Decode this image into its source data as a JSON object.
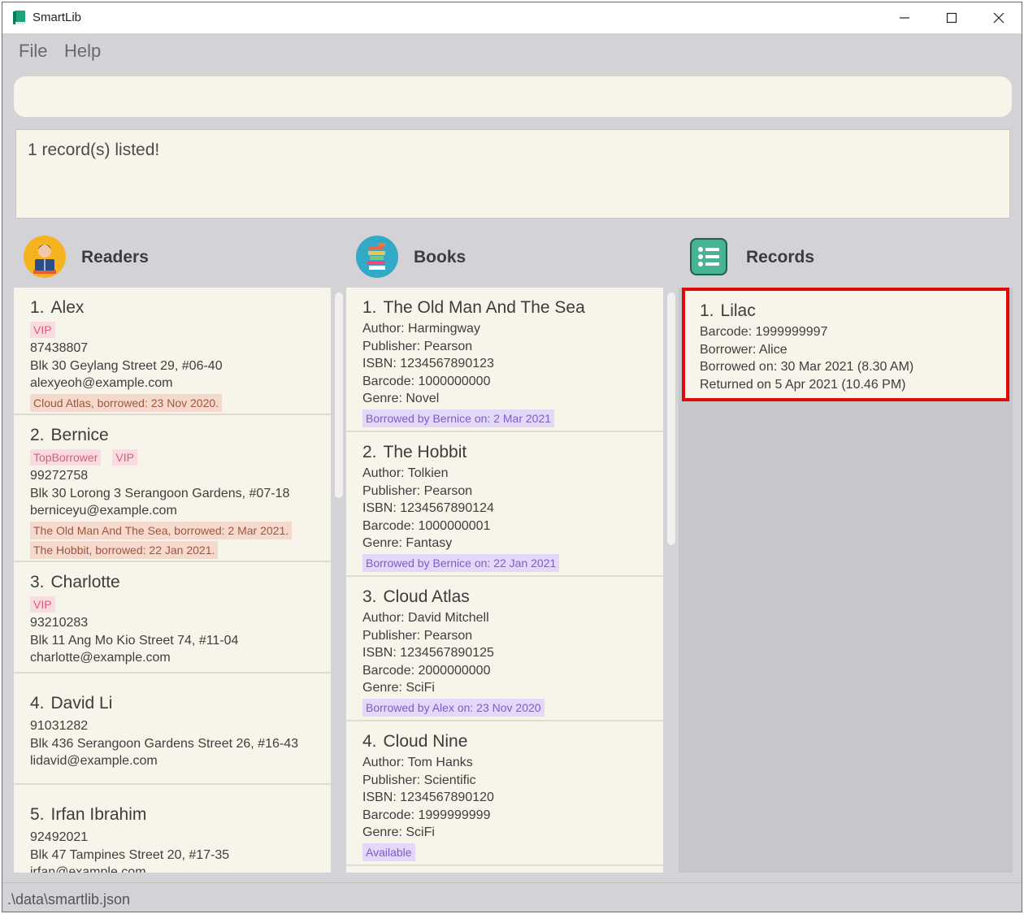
{
  "window": {
    "title": "SmartLib"
  },
  "menu": {
    "file": "File",
    "help": "Help"
  },
  "command": {
    "value": ""
  },
  "result": {
    "text": "1 record(s) listed!"
  },
  "panels": {
    "readers": "Readers",
    "books": "Books",
    "records": "Records"
  },
  "readers": [
    {
      "index": "1.",
      "name": "Alex",
      "tags": [
        "VIP"
      ],
      "phone": "87438807",
      "address": "Blk 30 Geylang Street 29, #06-40",
      "email": "alexyeoh@example.com",
      "borrowed": [
        "Cloud Atlas, borrowed: 23 Nov 2020."
      ]
    },
    {
      "index": "2.",
      "name": "Bernice",
      "tags": [
        "TopBorrower",
        "VIP"
      ],
      "phone": "99272758",
      "address": "Blk 30 Lorong 3 Serangoon Gardens, #07-18",
      "email": "berniceyu@example.com",
      "borrowed": [
        "The Old Man And The Sea, borrowed: 2 Mar 2021.",
        "The Hobbit, borrowed: 22 Jan 2021."
      ]
    },
    {
      "index": "3.",
      "name": "Charlotte",
      "tags": [
        "VIP"
      ],
      "phone": "93210283",
      "address": "Blk 11 Ang Mo Kio Street 74, #11-04",
      "email": "charlotte@example.com",
      "borrowed": []
    },
    {
      "index": "4.",
      "name": "David Li",
      "tags": [],
      "phone": "91031282",
      "address": "Blk 436 Serangoon Gardens Street 26, #16-43",
      "email": "lidavid@example.com",
      "borrowed": []
    },
    {
      "index": "5.",
      "name": "Irfan Ibrahim",
      "tags": [],
      "phone": "92492021",
      "address": "Blk 47 Tampines Street 20, #17-35",
      "email": "irfan@example.com",
      "borrowed": []
    }
  ],
  "books": [
    {
      "index": "1.",
      "title": "The Old Man And The Sea",
      "author": "Author: Harmingway",
      "publisher": "Publisher: Pearson",
      "isbn": "ISBN: 1234567890123",
      "barcode": "Barcode: 1000000000",
      "genre": "Genre: Novel",
      "status": "Borrowed by Bernice on: 2 Mar 2021"
    },
    {
      "index": "2.",
      "title": "The Hobbit",
      "author": "Author: Tolkien",
      "publisher": "Publisher: Pearson",
      "isbn": "ISBN: 1234567890124",
      "barcode": "Barcode: 1000000001",
      "genre": "Genre: Fantasy",
      "status": "Borrowed by Bernice on: 22 Jan 2021"
    },
    {
      "index": "3.",
      "title": "Cloud Atlas",
      "author": "Author: David Mitchell",
      "publisher": "Publisher: Pearson",
      "isbn": "ISBN: 1234567890125",
      "barcode": "Barcode: 2000000000",
      "genre": "Genre: SciFi",
      "status": "Borrowed by Alex on: 23 Nov 2020"
    },
    {
      "index": "4.",
      "title": "Cloud Nine",
      "author": "Author: Tom Hanks",
      "publisher": "Publisher: Scientific",
      "isbn": "ISBN: 1234567890120",
      "barcode": "Barcode: 1999999999",
      "genre": "Genre: SciFi",
      "status": "Available"
    }
  ],
  "records": [
    {
      "index": "1.",
      "name": "Lilac",
      "barcode": "Barcode: 1999999997",
      "borrower": "Borrower: Alice",
      "borrowed_on": "Borrowed on: 30 Mar 2021 (8.30 AM)",
      "returned_on": "Returned on 5 Apr 2021 (10.46 PM)"
    }
  ],
  "status_bar": {
    "path": ".\\data\\smartlib.json"
  },
  "icons": {
    "app": "book-icon",
    "readers": "reader-avatar-icon",
    "books": "book-stack-icon",
    "records": "list-icon"
  },
  "colors": {
    "background": "#d3d2d6",
    "card": "#f7f4ea",
    "highlight_border": "#e10a0a",
    "tag_text": "#d65f74",
    "tag_bg": "#fadbe2",
    "status_text": "#7b5ccc",
    "status_bg": "#e3d8fa"
  }
}
